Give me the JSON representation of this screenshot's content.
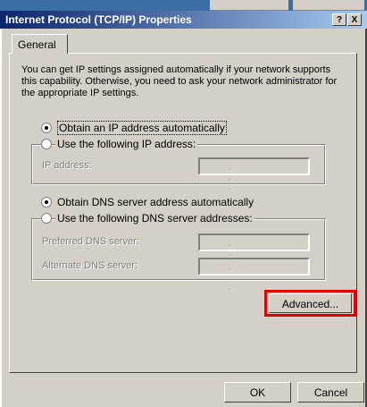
{
  "window": {
    "title": "Internet Protocol (TCP/IP) Properties",
    "help_button": "?",
    "close_button": "X"
  },
  "tabs": [
    {
      "label": "General"
    }
  ],
  "general": {
    "description": "You can get IP settings assigned automatically if your network supports this capability. Otherwise, you need to ask your network administrator for the appropriate IP settings.",
    "ip": {
      "auto_label": "Obtain an IP address automatically",
      "manual_label": "Use the following IP address:",
      "selected": "auto",
      "ip_address_label": "IP address:",
      "ip_address_value": ". . ."
    },
    "dns": {
      "auto_label": "Obtain DNS server address automatically",
      "manual_label": "Use the following DNS server addresses:",
      "selected": "auto",
      "preferred_label": "Preferred DNS server:",
      "alternate_label": "Alternate DNS server:",
      "field_value": ". . ."
    },
    "advanced_button": "Advanced...",
    "highlight_color": "#e00000"
  },
  "footer": {
    "ok_button": "OK",
    "cancel_button": "Cancel"
  }
}
